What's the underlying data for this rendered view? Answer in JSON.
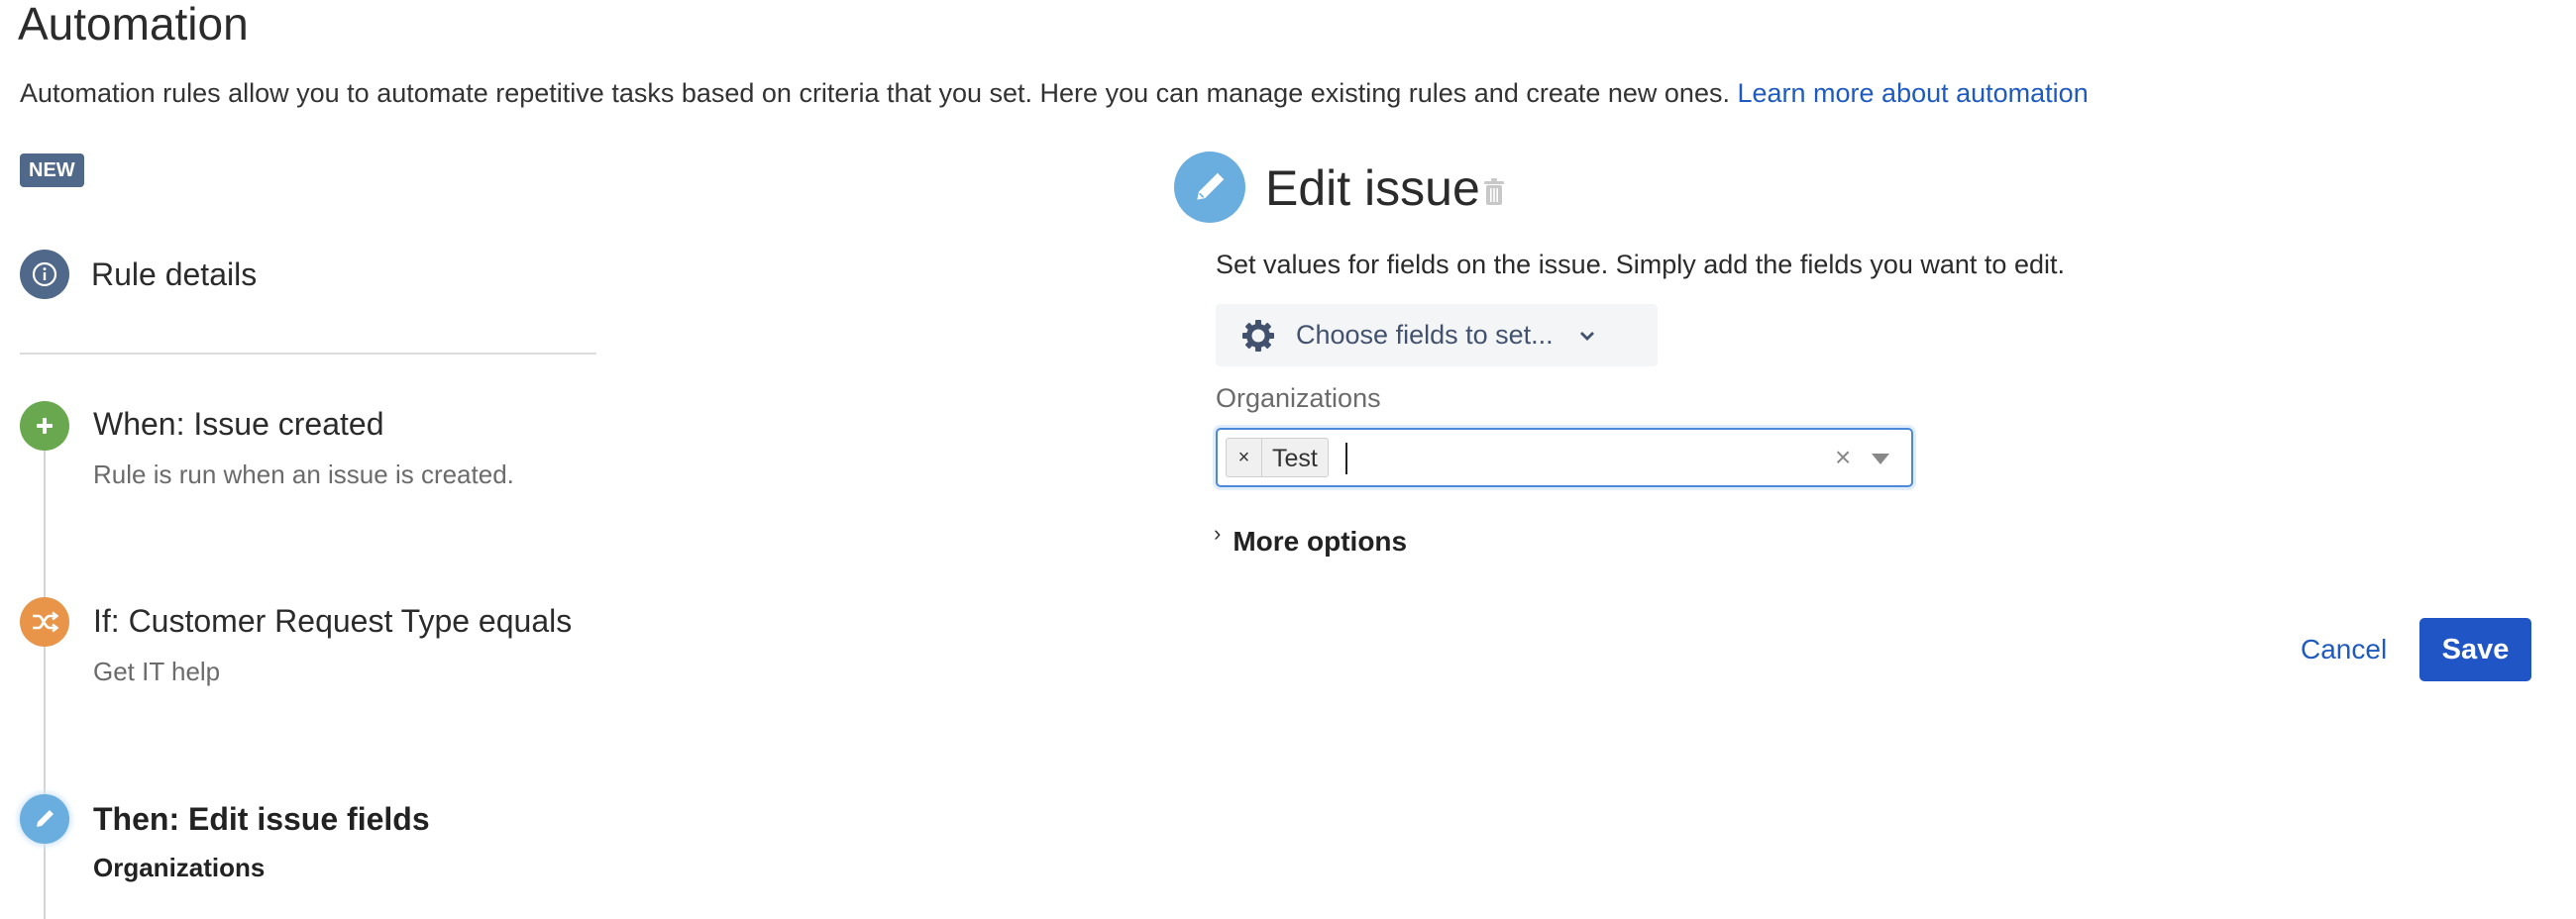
{
  "page": {
    "title": "Automation",
    "description": "Automation rules allow you to automate repetitive tasks based on criteria that you set. Here you can manage existing rules and create new ones.",
    "learn_more_link": "Learn more about automation"
  },
  "badge": {
    "label": "NEW"
  },
  "colors": {
    "rule_details": "#50688a",
    "when": "#6aa84f",
    "if": "#e8954a",
    "then": "#6aaddf",
    "primary": "#1f55c4",
    "link": "#1f5bbf"
  },
  "rule_details": {
    "label": "Rule details",
    "icon": "info-icon"
  },
  "steps": [
    {
      "type": "when",
      "icon": "plus-icon",
      "title": "When: Issue created",
      "subtitle": "Rule is run when an issue is created."
    },
    {
      "type": "if",
      "icon": "shuffle-icon",
      "title": "If: Customer Request Type equals",
      "subtitle": "Get IT help"
    },
    {
      "type": "then",
      "icon": "pencil-icon",
      "title": "Then: Edit issue fields",
      "subtitle": "Organizations",
      "selected": true
    }
  ],
  "editor": {
    "title": "Edit issue",
    "icon": "pencil-icon",
    "description": "Set values for fields on the issue. Simply add the fields you want to edit.",
    "choose_fields_label": "Choose fields to set...",
    "field": {
      "label": "Organizations",
      "selected_values": [
        {
          "label": "Test",
          "remove_glyph": "×"
        }
      ],
      "input_value": "",
      "clear_glyph": "×"
    },
    "more_options_label": "More options",
    "more_options_glyph": "›"
  },
  "actions": {
    "cancel_label": "Cancel",
    "save_label": "Save"
  }
}
